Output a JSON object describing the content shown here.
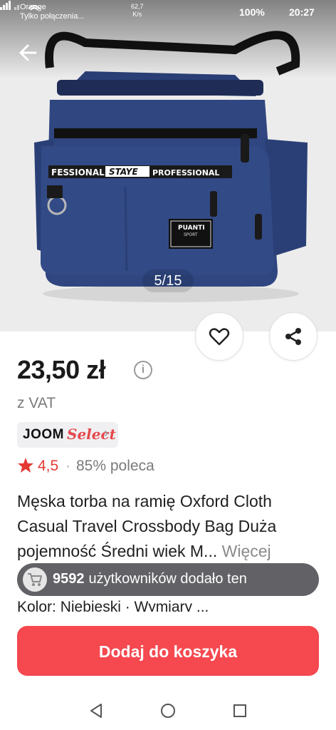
{
  "status_bar": {
    "carrier": "Orange",
    "network_note": "Tylko połączenia...",
    "speed_value": "62,7",
    "speed_unit": "K/s",
    "battery": "100%",
    "time": "20:27"
  },
  "gallery": {
    "counter": "5/15",
    "bag_labels": {
      "left_strip": "FESSIONAL",
      "center_strip": "STAYE",
      "right_strip": "PROFESSIONAL",
      "tag_brand": "PUANTI",
      "tag_sub": "SPORT"
    }
  },
  "product": {
    "price": "23,50 zł",
    "vat": "z VAT",
    "badge": {
      "brand": "JOOM",
      "label": "Select"
    },
    "rating": "4,5",
    "rating_separator": "·",
    "recommend": "85% poleca",
    "title": "Męska torba na ramię Oxford Cloth Casual Travel Crossbody Bag Duża pojemność Średni wiek M...",
    "more_label": "Więcej",
    "obscured_line": "Kolor: Niebieski · Wymiary ..."
  },
  "toast": {
    "count": "9592",
    "text": "użytkowników dodało ten"
  },
  "cart_button": "Dodaj do koszyka",
  "icons": {
    "back": "arrow-left-icon",
    "favorite": "heart-icon",
    "share": "share-icon",
    "info": "info-icon",
    "star": "star-icon",
    "cart": "cart-icon",
    "nav_back": "triangle-back-icon",
    "nav_home": "circle-home-icon",
    "nav_recents": "square-recents-icon"
  },
  "colors": {
    "accent": "#f5484f",
    "rating": "#e53935",
    "bag_blue": "#2f4680"
  }
}
